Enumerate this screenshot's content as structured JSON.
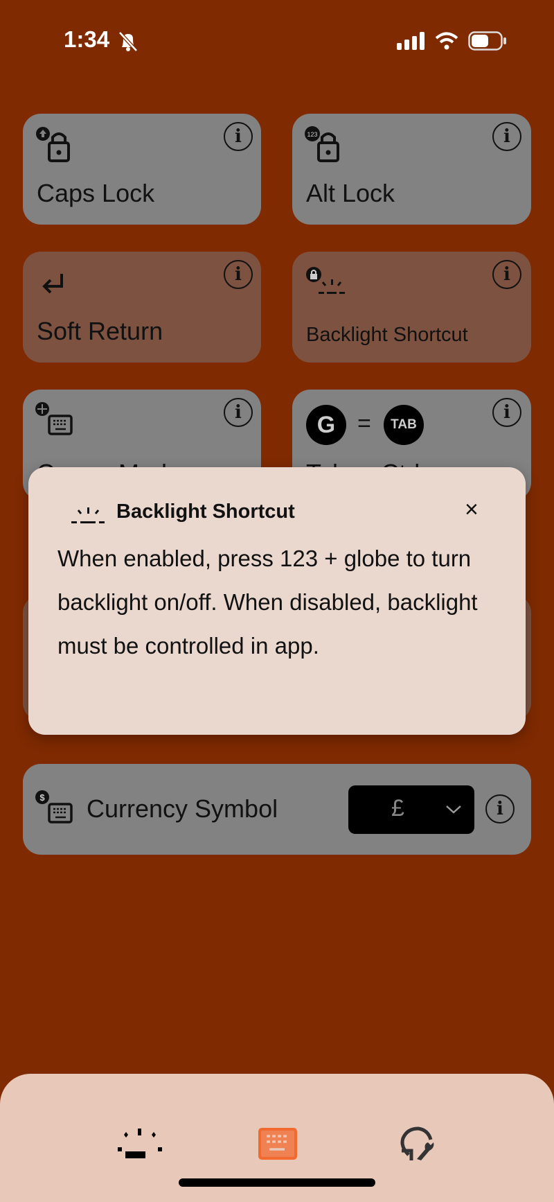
{
  "status_bar": {
    "time": "1:34",
    "silent": true,
    "battery_level": 0.5
  },
  "tiles": [
    {
      "label": "Caps Lock",
      "icon": "caps-lock-icon",
      "enabled": true
    },
    {
      "label": "Alt Lock",
      "icon": "alt-lock-icon",
      "badge": "123",
      "enabled": true
    },
    {
      "label": "Soft Return",
      "icon": "return-icon",
      "enabled": false
    },
    {
      "label": "Backlight Shortcut",
      "icon": "backlight-lock-icon",
      "enabled": false
    },
    {
      "label": "Cursor Mode",
      "icon": "cursor-keyboard-icon",
      "enabled": true
    },
    {
      "label": "Tab ⇐ Ctrl",
      "icon": "globe-tab-icon",
      "key_left": "G",
      "equals": "=",
      "key_right": "TAB",
      "enabled": true
    }
  ],
  "currency": {
    "label": "Currency Symbol",
    "value": "£"
  },
  "popup": {
    "title": "Backlight Shortcut",
    "body": "When enabled, press 123 + globe to turn backlight on/off. When disabled, backlight must be controlled in app.",
    "close": "×"
  },
  "tabbar": {
    "items": [
      {
        "icon": "backlight-icon",
        "active": false
      },
      {
        "icon": "keyboard-icon",
        "active": true
      },
      {
        "icon": "update-wrench-icon",
        "active": false
      }
    ],
    "accent": "#f26a30"
  }
}
